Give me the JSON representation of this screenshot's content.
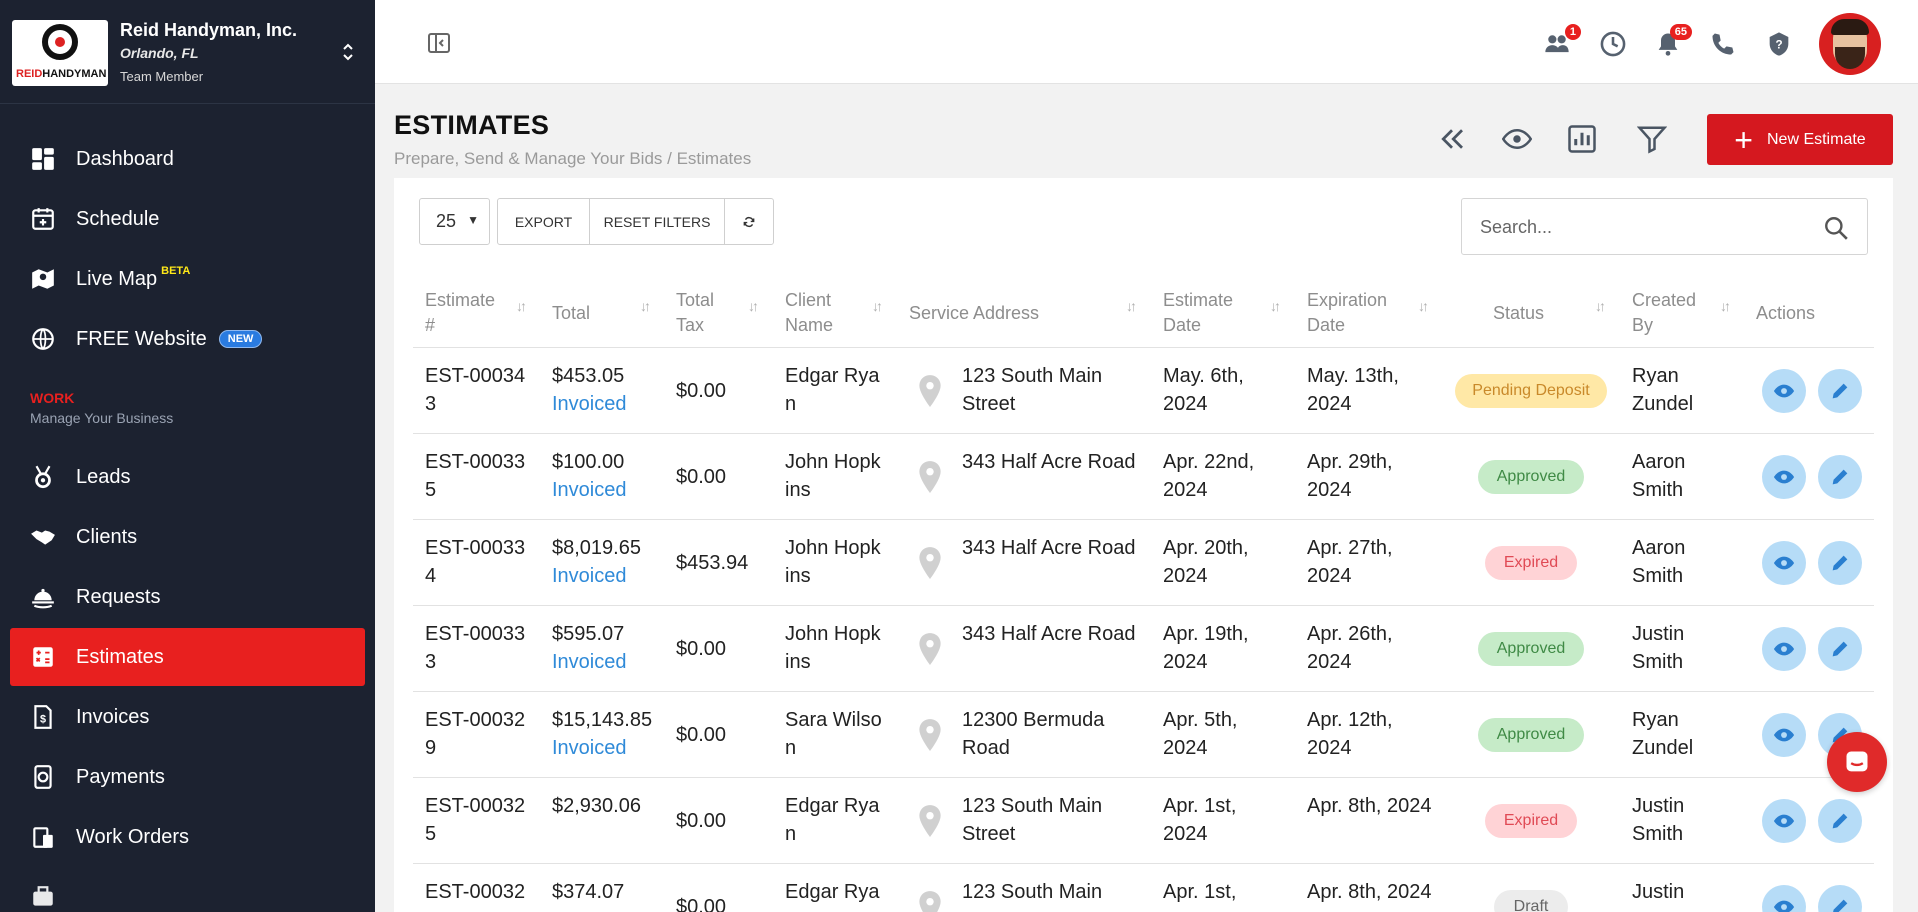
{
  "brand": {
    "name": "Reid Handyman, Inc.",
    "location": "Orlando, FL",
    "role": "Team Member",
    "logo_text_red": "REID",
    "logo_text_dark": "HANDYMAN"
  },
  "sidebar": {
    "items": [
      {
        "label": "Dashboard",
        "icon": "dashboard-icon"
      },
      {
        "label": "Schedule",
        "icon": "calendar-icon"
      },
      {
        "label": "Live Map",
        "icon": "map-icon",
        "tag": "BETA"
      },
      {
        "label": "FREE Website",
        "icon": "globe-icon",
        "pill": "NEW"
      },
      {
        "label": "Leads",
        "icon": "medal-icon"
      },
      {
        "label": "Clients",
        "icon": "handshake-icon"
      },
      {
        "label": "Requests",
        "icon": "bell-hand-icon"
      },
      {
        "label": "Estimates",
        "icon": "calculator-icon",
        "active": true
      },
      {
        "label": "Invoices",
        "icon": "invoice-icon"
      },
      {
        "label": "Payments",
        "icon": "payments-icon"
      },
      {
        "label": "Work Orders",
        "icon": "work-orders-icon"
      }
    ],
    "section": {
      "title": "WORK",
      "subtitle": "Manage Your Business"
    }
  },
  "topbar": {
    "team_badge": "1",
    "notif_badge": "65"
  },
  "header": {
    "title": "ESTIMATES",
    "breadcrumb": "Prepare, Send & Manage Your Bids / Estimates",
    "new_button": "New Estimate"
  },
  "toolbar": {
    "per_page": "25",
    "export_label": "EXPORT",
    "reset_label": "RESET FILTERS",
    "search_placeholder": "Search..."
  },
  "table": {
    "columns": [
      "Estimate #",
      "Total",
      "Total Tax",
      "Client Name",
      "Service Address",
      "Estimate Date",
      "Expiration Date",
      "Status",
      "Created By",
      "Actions"
    ],
    "rows": [
      {
        "num": "EST-00034 3",
        "total": "$453.05",
        "invoiced": "Invoiced",
        "tax": "$0.00",
        "client": "Edgar Rya n",
        "address": "123 South Main Street",
        "est_date": "May. 6th, 2024",
        "exp_date": "May. 13th, 2024",
        "status": "Pending Deposit",
        "status_type": "pending",
        "created": "Ryan Zundel"
      },
      {
        "num": "EST-00033 5",
        "total": "$100.00",
        "invoiced": "Invoiced",
        "tax": "$0.00",
        "client": "John Hopk ins",
        "address": "343 Half Acre Road",
        "est_date": "Apr. 22nd, 2024",
        "exp_date": "Apr. 29th, 2024",
        "status": "Approved",
        "status_type": "approved",
        "created": "Aaron Smith"
      },
      {
        "num": "EST-00033 4",
        "total": "$8,019.65",
        "invoiced": "Invoiced",
        "tax": "$453.94",
        "client": "John Hopk ins",
        "address": "343 Half Acre Road",
        "est_date": "Apr. 20th, 2024",
        "exp_date": "Apr. 27th, 2024",
        "status": "Expired",
        "status_type": "expired",
        "created": "Aaron Smith"
      },
      {
        "num": "EST-00033 3",
        "total": "$595.07",
        "invoiced": "Invoiced",
        "tax": "$0.00",
        "client": "John Hopk ins",
        "address": "343 Half Acre Road",
        "est_date": "Apr. 19th, 2024",
        "exp_date": "Apr. 26th, 2024",
        "status": "Approved",
        "status_type": "approved",
        "created": "Justin Smith"
      },
      {
        "num": "EST-00032 9",
        "total": "$15,143.85",
        "invoiced": "Invoiced",
        "tax": "$0.00",
        "client": "Sara Wilso n",
        "address": "12300 Bermuda Road",
        "est_date": "Apr. 5th, 2024",
        "exp_date": "Apr. 12th, 2024",
        "status": "Approved",
        "status_type": "approved",
        "created": "Ryan Zundel"
      },
      {
        "num": "EST-00032 5",
        "total": "$2,930.06",
        "invoiced": "",
        "tax": "$0.00",
        "client": "Edgar Rya n",
        "address": "123 South Main Street",
        "est_date": "Apr. 1st, 2024",
        "exp_date": "Apr. 8th, 2024",
        "status": "Expired",
        "status_type": "expired",
        "created": "Justin Smith"
      },
      {
        "num": "EST-00032",
        "total": "$374.07",
        "invoiced": "",
        "tax": "$0.00",
        "client": "Edgar Rya",
        "address": "123 South Main",
        "est_date": "Apr. 1st,",
        "exp_date": "Apr. 8th, 2024",
        "status": "Draft",
        "status_type": "draft",
        "created": "Justin"
      }
    ]
  },
  "colors": {
    "sidebar_bg": "#1c2230",
    "accent_red": "#e8201f",
    "link_blue": "#2f8ad8",
    "action_bg": "#b6dcf7"
  }
}
